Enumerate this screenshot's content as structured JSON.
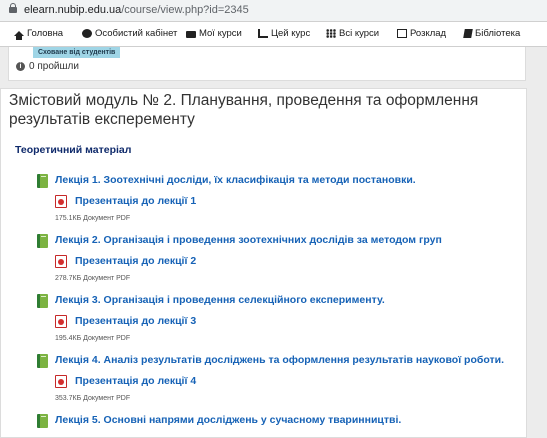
{
  "browser": {
    "url_host": "elearn.nubip.edu.ua",
    "url_path": "/course/view.php?id=2345"
  },
  "nav": {
    "items": [
      {
        "label": "Головна",
        "icon": "home-icon"
      },
      {
        "label": "Особистий кабінет",
        "icon": "dashboard-icon"
      },
      {
        "label": "Мої курси",
        "icon": "briefcase-icon"
      },
      {
        "label": "Цей курс",
        "icon": "chart-icon"
      },
      {
        "label": "Всі курси",
        "icon": "grid-icon"
      },
      {
        "label": "Розклад",
        "icon": "calendar-icon"
      },
      {
        "label": "Бібліотека",
        "icon": "book-icon"
      }
    ]
  },
  "top_card": {
    "badge": "Сховане від студентів",
    "info_icon": "i",
    "passed": "0 пройшли"
  },
  "section": {
    "title": "Змістовий модуль № 2. Планування, проведення та оформлення результатів експеременту",
    "subheading": "Теоретичний матеріал",
    "lectures": [
      {
        "title": "Лекція 1. Зоотехнічні досліди, їх класифікація та методи постановки.",
        "presentation": "Презентація до лекції 1",
        "meta": "175.1КБ Документ PDF"
      },
      {
        "title": "Лекція 2. Організація і проведення зоотехнічних дослідів за методом груп",
        "presentation": "Презентація до лекції 2",
        "meta": "278.7КБ Документ PDF"
      },
      {
        "title": "Лекція 3. Організація і проведення селекційного експерименту.",
        "presentation": "Презентація до лекції 3",
        "meta": "195.4КБ Документ PDF"
      },
      {
        "title": "Лекція 4. Аналіз результатів досліджень та оформлення результатів наукової роботи.",
        "presentation": "Презентація до лекції 4",
        "meta": "353.7КБ Документ PDF"
      },
      {
        "title": "Лекція 5. Основні напрями досліджень у сучасному тваринництві."
      }
    ]
  }
}
